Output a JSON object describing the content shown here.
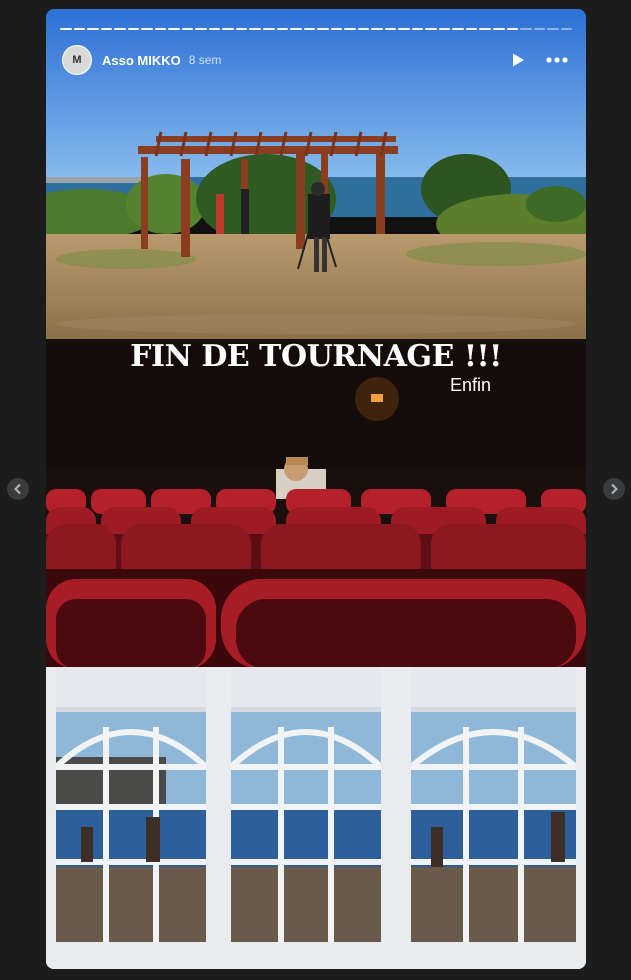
{
  "story": {
    "username": "Asso MIKKO",
    "time": "8 sem",
    "avatar_text": "M",
    "progress_total": 38,
    "progress_done": 34,
    "title": "FIN DE TOURNAGE !!!",
    "subtitle": "Enfin"
  },
  "icons": {
    "play": "play-icon",
    "more": "more-dots-icon",
    "prev": "chevron-left-icon",
    "next": "chevron-right-icon"
  }
}
